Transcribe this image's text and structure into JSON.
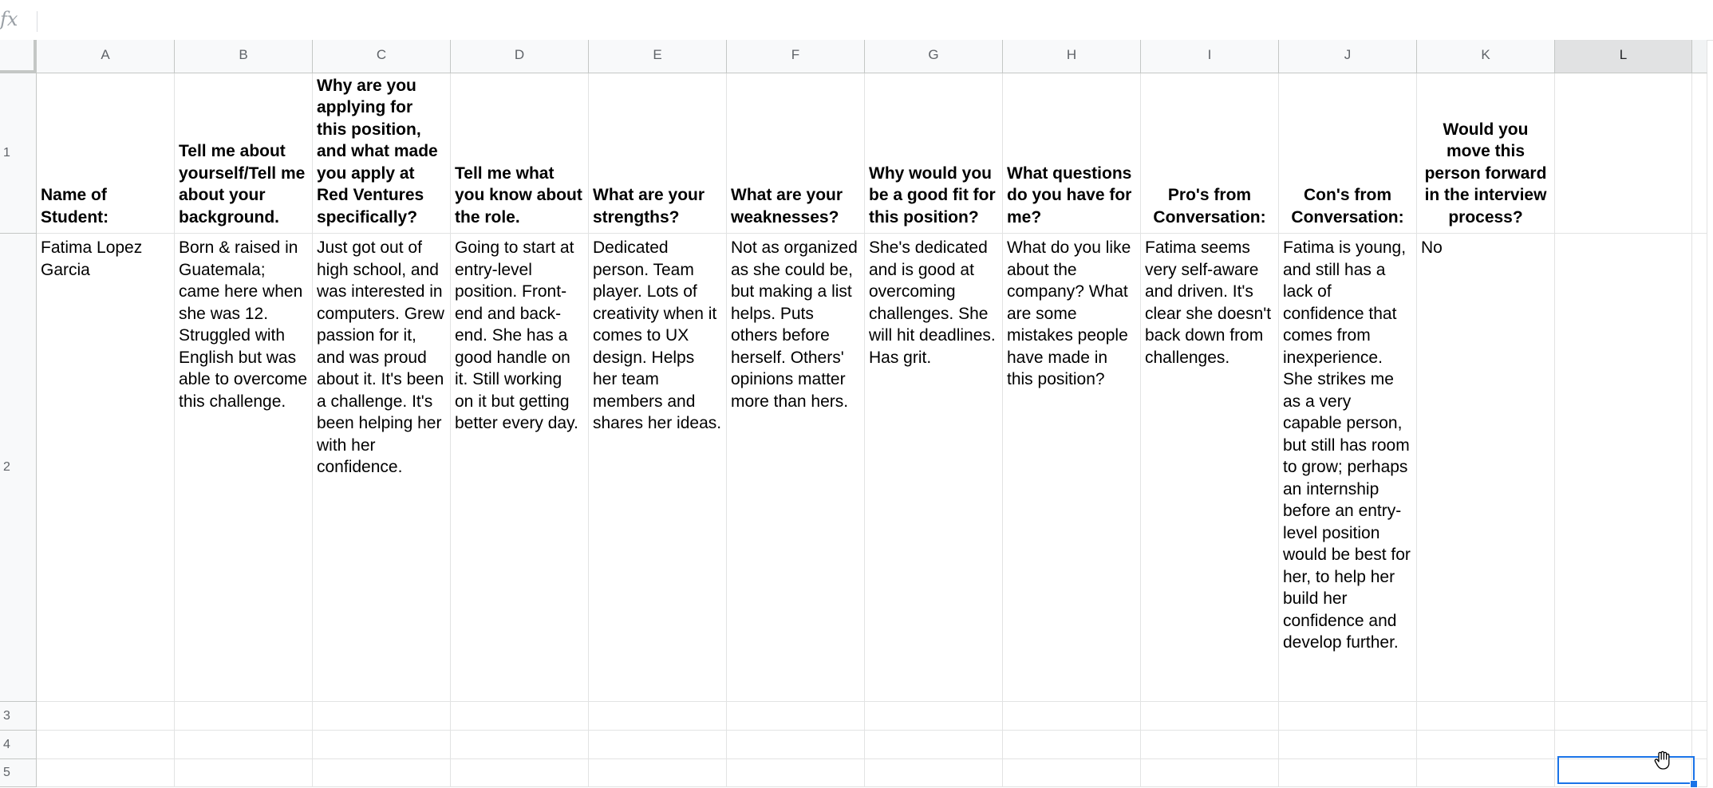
{
  "formula_bar": {
    "fx_label": "fx",
    "value": ""
  },
  "columns": [
    "A",
    "B",
    "C",
    "D",
    "E",
    "F",
    "G",
    "H",
    "I",
    "J",
    "K",
    "L"
  ],
  "rows": [
    "1",
    "2",
    "3",
    "4",
    "5"
  ],
  "selected_cell": "L5",
  "header_row": {
    "A": "Name of Student:",
    "B": "Tell me about yourself/Tell me about your background.",
    "C": "Why are you applying for this position, and what made you apply at Red Ventures specifically?",
    "D": "Tell me what you know about the role.",
    "E": "What are your strengths?",
    "F": "What are your weaknesses?",
    "G": "Why would you be a good fit for this position?",
    "H": "What questions do you have for me?",
    "I": "Pro's from Conversation:",
    "J": "Con's from Conversation:",
    "K": "Would you move this person forward in the interview process?",
    "L": ""
  },
  "data_row": {
    "A": "Fatima Lopez Garcia",
    "B": "Born & raised in Guatemala; came here when she was 12. Struggled with English but was able to overcome this challenge.",
    "C": "Just got out of high school, and was interested in computers. Grew passion for it, and was proud about it. It's been a challenge. It's been helping her with her confidence.",
    "D": "Going to start at entry-level position. Front-end and back-end. She has a good handle on it. Still working on it but getting better every day.",
    "E": "Dedicated person. Team player. Lots of creativity when it comes to UX design. Helps her team members and shares her ideas.",
    "F": "Not as organized as she could be, but making a list helps. Puts others before herself. Others' opinions matter more than hers.",
    "G": "She's dedicated and is good at overcoming challenges. She will hit deadlines. Has grit.",
    "H": "What do you like about the company? What are some mistakes people have made in this position?",
    "I": "Fatima seems very self-aware and driven. It's clear she doesn't back down from challenges.",
    "J": "Fatima is young, and still has a lack of confidence that comes from inexperience. She strikes me as a very capable person, but still has room to grow; perhaps an internship before an entry-level position would be best for her, to help her build her confidence and develop further.",
    "K": "No",
    "L": ""
  },
  "colors": {
    "selection": "#1a73e8",
    "header_bg": "#f8f9fa",
    "gridline": "#e2e3e3"
  },
  "icons": {
    "cursor": "hand-cursor-icon"
  }
}
